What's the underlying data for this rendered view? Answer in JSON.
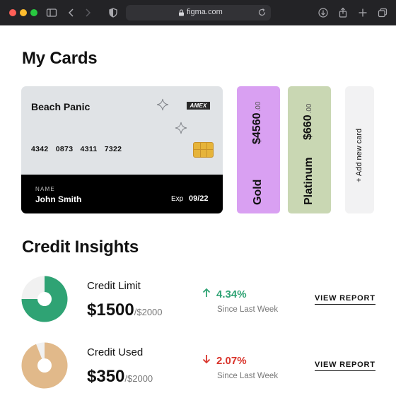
{
  "browser": {
    "url": "figma.com"
  },
  "cards_section": {
    "title": "My Cards",
    "main_card": {
      "bank_name": "Beach Panic",
      "brand": "AMEX",
      "number": "4342 0873 4311 7322",
      "name_label": "NAME",
      "holder_name": "John Smith",
      "exp_label": "Exp",
      "exp_value": "09/22"
    },
    "gold_card": {
      "amount": "$4560",
      "cents": ".00",
      "tier": "Gold",
      "color": "#d9a0f2"
    },
    "platinum_card": {
      "amount": "$660",
      "cents": ".00",
      "tier": "Platinum",
      "color": "#c9d7b3"
    },
    "add_card_label": "+ Add new card"
  },
  "insights_section": {
    "title": "Credit Insights",
    "items": [
      {
        "label": "Credit Limit",
        "amount": "$1500",
        "limit": "/$2000",
        "change": "4.34%",
        "direction": "up",
        "since": "Since Last Week",
        "report_label": "VIEW REPORT",
        "pie_fraction": 0.75,
        "pie_color": "#2fa374",
        "change_color": "#2fa374"
      },
      {
        "label": "Credit Used",
        "amount": "$350",
        "limit": "/$2000",
        "change": "2.07%",
        "direction": "down",
        "since": "Since Last Week",
        "report_label": "VIEW REPORT",
        "pie_fraction": 0.94,
        "pie_color": "#e1b98a",
        "change_color": "#d9342b"
      }
    ]
  }
}
